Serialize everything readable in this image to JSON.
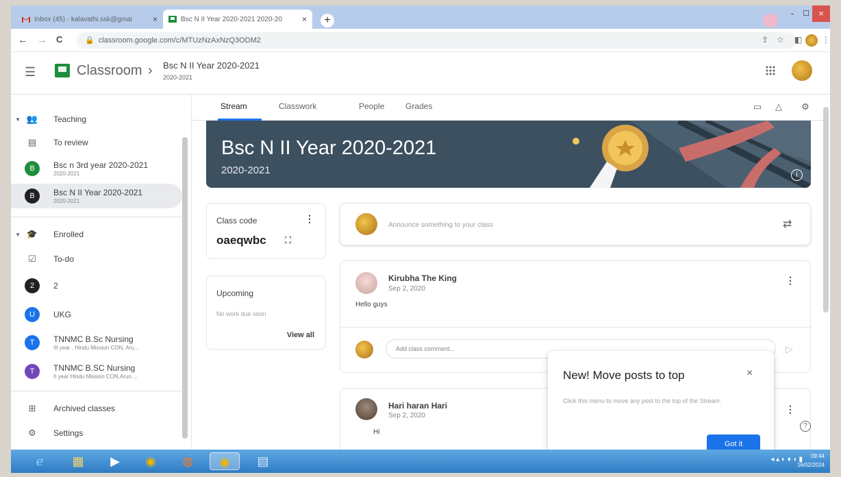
{
  "browser": {
    "tabs": [
      {
        "title": "Inbox (45) - kalavathi.ssk@gmai",
        "close": "×"
      },
      {
        "title": "Bsc N II Year 2020-2021 2020-20",
        "close": "×"
      }
    ],
    "new_tab": "+",
    "url": "classroom.google.com/c/MTUzNzAxNzQ3ODM2",
    "nav": {
      "back": "←",
      "forward": "→",
      "reload": "C"
    },
    "window": {
      "minimize": "-",
      "maximize": "☐",
      "close": "×"
    }
  },
  "header": {
    "menu_icon": "☰",
    "brand": "Classroom",
    "separator": "›",
    "class_title": "Bsc N II Year 2020-2021",
    "class_subtitle": "2020-2021",
    "apps_icon": "⋮⋮⋮"
  },
  "sidebar": {
    "teaching": "Teaching",
    "to_review": "To review",
    "teaching_classes": [
      {
        "initial": "B",
        "name": "Bsc n 3rd year 2020-2021",
        "sub": "2020-2021",
        "color": "#1e8e3e"
      },
      {
        "initial": "B",
        "name": "Bsc N II Year 2020-2021",
        "sub": "2020-2021",
        "color": "#202124"
      }
    ],
    "enrolled": "Enrolled",
    "todo": "To-do",
    "enrolled_classes": [
      {
        "initial": "2",
        "name": "2",
        "sub": "",
        "color": "#202124"
      },
      {
        "initial": "U",
        "name": "UKG",
        "sub": "",
        "color": "#1a73e8"
      },
      {
        "initial": "T",
        "name": "TNNMC B.Sc Nursing",
        "sub": "III year , Hindu Mission CON, Aru...",
        "color": "#1a73e8"
      },
      {
        "initial": "T",
        "name": "TNNMC B.SC Nursing",
        "sub": "II year Hindu Mission CON,Arun ...",
        "color": "#7248b9"
      }
    ],
    "archived": "Archived classes",
    "settings": "Settings"
  },
  "tabs": {
    "stream": "Stream",
    "classwork": "Classwork",
    "people": "People",
    "grades": "Grades"
  },
  "banner": {
    "title": "Bsc N II Year 2020-2021",
    "subtitle": "2020-2021",
    "info": "i"
  },
  "class_code": {
    "label": "Class code",
    "value": "oaeqwbc"
  },
  "upcoming": {
    "label": "Upcoming",
    "empty": "No work due soon",
    "view_all": "View all"
  },
  "announce": {
    "placeholder": "Announce something to your class"
  },
  "posts": [
    {
      "author": "Kirubha The King",
      "date": "Sep 2, 2020",
      "body": "Hello guys"
    },
    {
      "author": "Hari haran Hari",
      "date": "Sep 2, 2020",
      "body": "Hi"
    }
  ],
  "comment": {
    "placeholder": "Add class comment..."
  },
  "popup": {
    "title": "New! Move posts to top",
    "body": "Click this menu to move any post to the top of the Stream.",
    "button": "Got it",
    "close": "×"
  },
  "taskbar": {
    "time": "09:44",
    "date": "16/02/2024"
  }
}
